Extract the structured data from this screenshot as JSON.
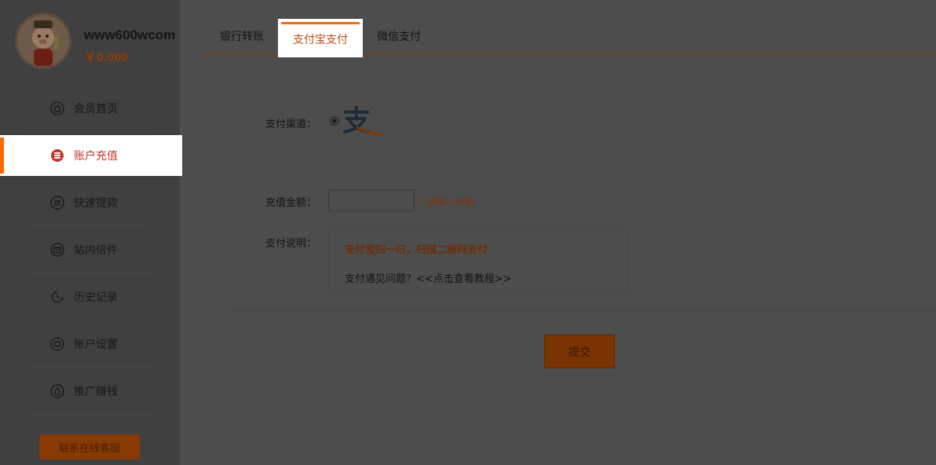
{
  "user": {
    "name": "www600wcom",
    "balance": "￥0.000"
  },
  "sidebar": {
    "items": [
      {
        "label": "会员首页",
        "icon": "home-icon"
      },
      {
        "label": "账户充值",
        "icon": "coins-icon",
        "active": true
      },
      {
        "label": "快速提款",
        "icon": "withdraw-icon"
      },
      {
        "label": "站内信件",
        "icon": "mail-icon"
      },
      {
        "label": "历史记录",
        "icon": "history-icon"
      },
      {
        "label": "账户设置",
        "icon": "settings-icon"
      },
      {
        "label": "推广赚钱",
        "icon": "droplet-icon"
      }
    ],
    "service_button": "联系在线客服"
  },
  "tabs": [
    {
      "label": "银行转账"
    },
    {
      "label": "支付宝支付",
      "active": true
    },
    {
      "label": "微信支付"
    }
  ],
  "form": {
    "channel_label": "支付渠道：",
    "channel_logo_text": "支",
    "amount_label": "充值金额：",
    "amount_value": "",
    "amount_hint": "* 请输入金额",
    "desc_label": "支付说明：",
    "desc_title": "支付宝扫一扫，扫描二维码支付",
    "desc_line": "支付遇见问题？<<点击查看教程>>",
    "submit": "提交"
  },
  "colors": {
    "accent": "#ff6a00",
    "active_text": "#c4352c"
  }
}
